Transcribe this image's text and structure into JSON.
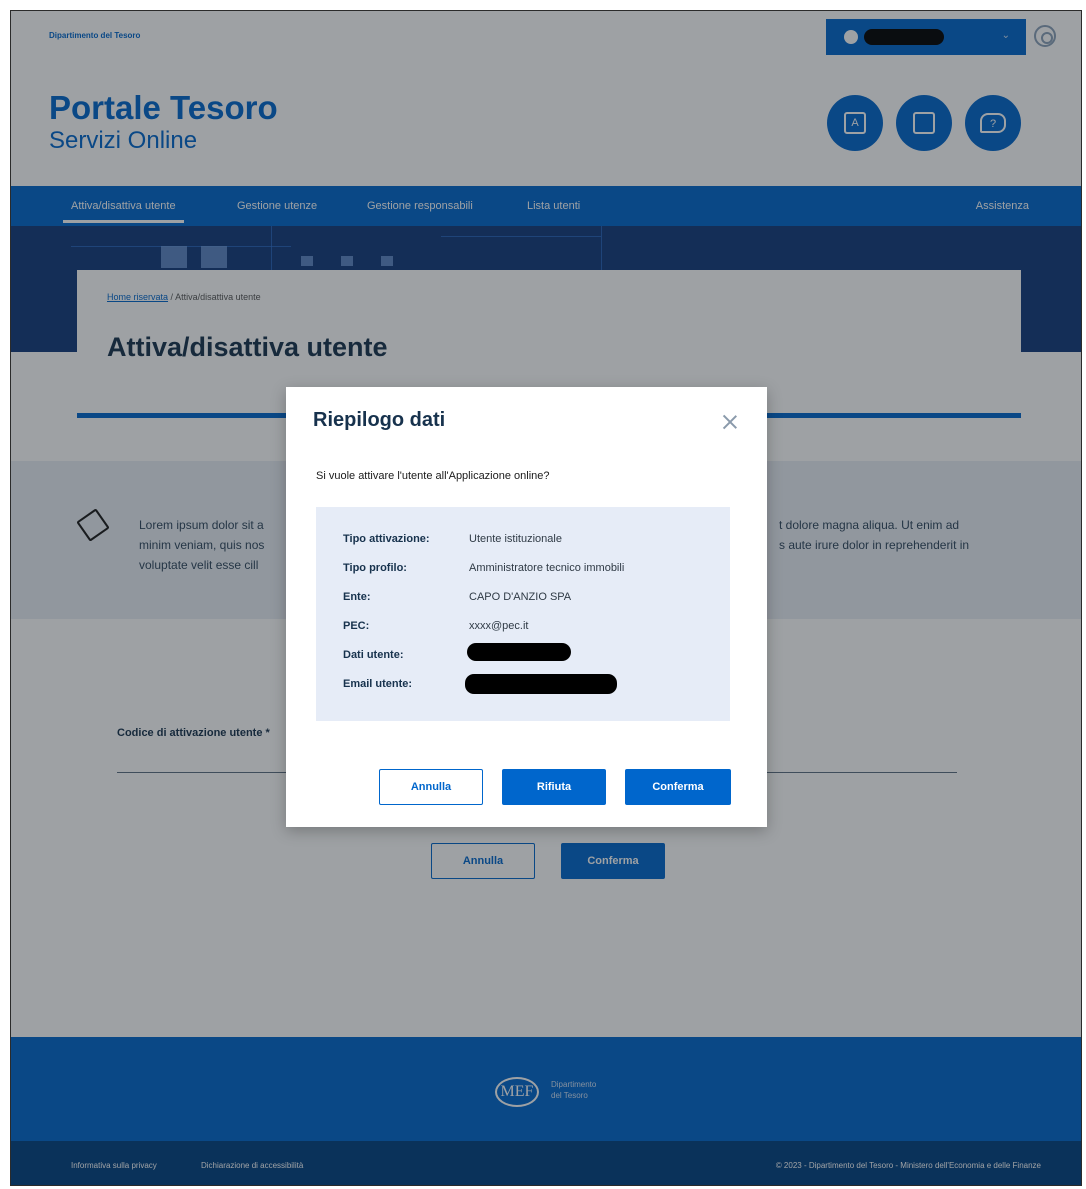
{
  "topbar": {
    "department": "Dipartimento del Tesoro",
    "user_chevron": "⌄"
  },
  "header": {
    "title": "Portale Tesoro",
    "subtitle": "Servizi Online",
    "circle_buttons": [
      "glossary-icon",
      "book-icon",
      "help-chat-icon"
    ]
  },
  "nav": {
    "items": [
      {
        "label": "Attiva/disattiva utente",
        "active": true
      },
      {
        "label": "Gestione utenze",
        "active": false
      },
      {
        "label": "Gestione responsabili",
        "active": false
      },
      {
        "label": "Lista utenti",
        "active": false
      }
    ],
    "assistance": "Assistenza"
  },
  "page": {
    "breadcrumb_home": "Home riservata",
    "breadcrumb_sep": "/",
    "breadcrumb_current": "Attiva/disattiva utente",
    "title": "Attiva/disattiva utente"
  },
  "info": {
    "text_left": "Lorem ipsum dolor sit a",
    "text_left_2": "minim veniam, quis nos",
    "text_left_3": "voluptate velit esse cill",
    "text_right": "t dolore magna aliqua. Ut enim ad",
    "text_right_2": "s aute irure dolor in reprehenderit in"
  },
  "form": {
    "code_label": "Codice di attivazione utente *",
    "cancel": "Annulla",
    "confirm": "Conferma"
  },
  "modal": {
    "title": "Riepilogo dati",
    "question": "Si vuole attivare l'utente all'Applicazione online?",
    "fields": [
      {
        "key": "Tipo attivazione:",
        "value": "Utente istituzionale"
      },
      {
        "key": "Tipo profilo:",
        "value": "Amministratore tecnico immobili"
      },
      {
        "key": "Ente:",
        "value": "CAPO D'ANZIO SPA"
      },
      {
        "key": "PEC:",
        "value": "xxxx@pec.it"
      },
      {
        "key": "Dati utente:",
        "value": ""
      },
      {
        "key": "Email utente:",
        "value": ""
      }
    ],
    "cancel": "Annulla",
    "reject": "Rifiuta",
    "confirm": "Conferma"
  },
  "footer": {
    "logo": "MEF",
    "dept_line1": "Dipartimento",
    "dept_line2": "del Tesoro",
    "link_privacy": "Informativa sulla privacy",
    "link_accessibility": "Dichiarazione di accessibilità",
    "copyright": "©  2023 - Dipartimento del Tesoro - Ministero dell'Economia e delle Finanze"
  },
  "colors": {
    "primary": "#0066cc",
    "dark_text": "#17324d",
    "summary_bg": "#e6ecf7",
    "hero": "#123a7a"
  }
}
